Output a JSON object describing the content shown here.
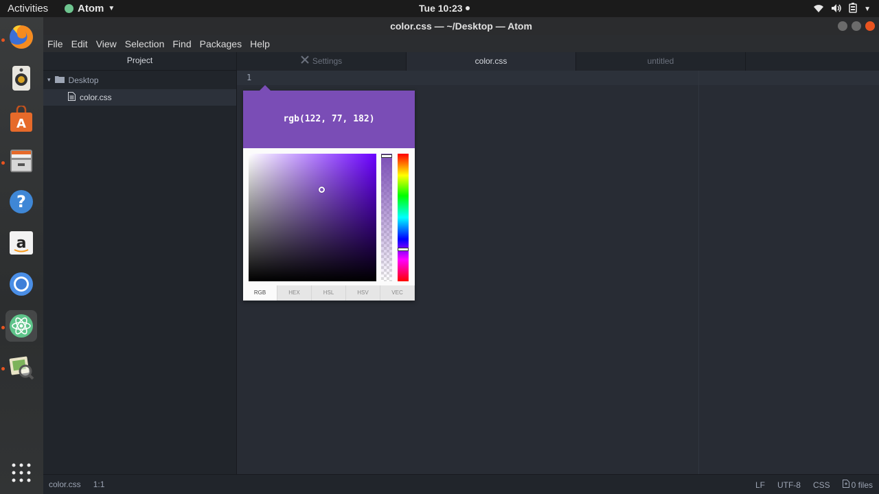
{
  "topbar": {
    "activities": "Activities",
    "app_name": "Atom",
    "clock": "Tue 10:23"
  },
  "dock": {
    "items": [
      "firefox-icon",
      "rhythmbox-icon",
      "software-center-icon",
      "files-icon",
      "help-icon",
      "amazon-icon",
      "chromium-icon",
      "atom-icon",
      "image-viewer-icon",
      "app-grid-icon"
    ]
  },
  "window": {
    "title": "color.css — ~/Desktop — Atom"
  },
  "menu": {
    "items": [
      "File",
      "Edit",
      "View",
      "Selection",
      "Find",
      "Packages",
      "Help"
    ]
  },
  "tree": {
    "header": "Project",
    "folder": "Desktop",
    "file": "color.css"
  },
  "tabs": {
    "settings": "Settings",
    "color": "color.css",
    "untitled": "untitled"
  },
  "editor": {
    "line_number": "1"
  },
  "picker": {
    "value": "rgb(122, 77, 182)",
    "color": "#7a4db6",
    "formats": [
      "RGB",
      "HEX",
      "HSL",
      "HSV",
      "VEC"
    ],
    "active_format": "RGB"
  },
  "status": {
    "file": "color.css",
    "cursor": "1:1",
    "line_ending": "LF",
    "encoding": "UTF-8",
    "grammar": "CSS",
    "files": "0 files"
  }
}
